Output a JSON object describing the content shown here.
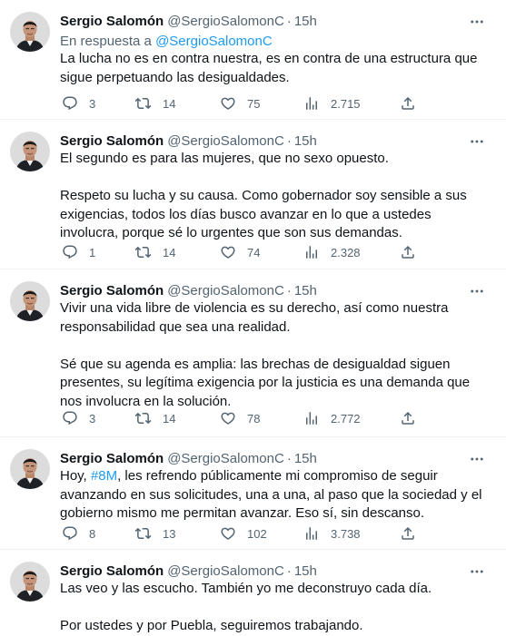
{
  "author": {
    "name": "Sergio Salomón",
    "handle": "@SergioSalomonC",
    "dot": "·"
  },
  "tweets": [
    {
      "time": "15h",
      "reply_prefix": "En respuesta a",
      "reply_to": "@SergioSalomonC",
      "paragraphs": [
        "La lucha no es en contra nuestra, es en contra de una estructura que sigue perpetuando las desigualdades."
      ],
      "replies": "3",
      "retweets": "14",
      "likes": "75",
      "views": "2.715"
    },
    {
      "time": "15h",
      "paragraphs": [
        "El segundo es para las mujeres, que no sexo opuesto.",
        "Respeto su lucha y su causa. Como gobernador soy sensible a sus exigencias, todos los días busco avanzar en lo que a ustedes involucra, porque sé lo urgentes que son sus demandas."
      ],
      "replies": "1",
      "retweets": "14",
      "likes": "74",
      "views": "2.328"
    },
    {
      "time": "15h",
      "paragraphs": [
        "Vivir una vida libre de violencia es su derecho, así como nuestra responsabilidad que sea una realidad.",
        "Sé que su agenda es amplia: las brechas de desigualdad siguen presentes, su legítima exigencia por la justicia es una demanda que nos involucra en la solución."
      ],
      "replies": "3",
      "retweets": "14",
      "likes": "78",
      "views": "2.772"
    },
    {
      "time": "15h",
      "p1_before": "Hoy, ",
      "hashtag": "#8M",
      "p1_after": ", les refrendo públicamente mi compromiso de seguir avanzando en sus solicitudes, una a una, al paso que la sociedad y el gobierno mismo me permitan avanzar. Eso sí, sin descanso.",
      "replies": "8",
      "retweets": "13",
      "likes": "102",
      "views": "3.738"
    },
    {
      "time": "15h",
      "paragraphs": [
        "Las veo y las escucho. También yo me deconstruyo cada día.",
        "Por ustedes y por Puebla, seguiremos trabajando."
      ]
    }
  ],
  "icons": {
    "reply": "reply-icon",
    "retweet": "retweet-icon",
    "like": "heart-icon",
    "views": "views-icon",
    "share": "share-icon",
    "more": "more-options-icon"
  },
  "colors": {
    "text": "#0f1419",
    "secondary": "#536471",
    "link": "#1d9bf0",
    "divider": "#eff3f4"
  }
}
